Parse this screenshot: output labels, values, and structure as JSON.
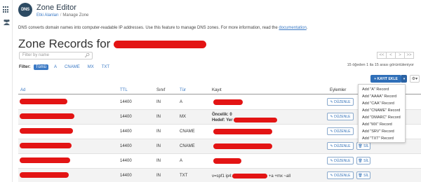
{
  "leftbar": {
    "icons": [
      "grid-icon",
      "users-icon"
    ]
  },
  "header": {
    "logo_text": "DNS",
    "title": "Zone Editor",
    "breadcrumb_home": "Etki Alanları",
    "breadcrumb_sep": "/",
    "breadcrumb_current": "Manage Zone"
  },
  "description": {
    "text": "DNS converts domain names into computer-readable IP addresses. Use this feature to manage DNS zones. For more information, read the",
    "link": "documentation",
    "suffix": "."
  },
  "page": {
    "title": "Zone Records for"
  },
  "search": {
    "placeholder": "Filter by name",
    "icon": "search-icon"
  },
  "filter": {
    "label": "Filter:",
    "chips": [
      "Tümü",
      "A",
      "CNAME",
      "MX",
      "TXT"
    ]
  },
  "pager": {
    "first": "<<",
    "prev": "<",
    "next": ">",
    "last": ">>"
  },
  "count_text": "15 öğeden 1 ila 15 arası görüntüleniyor",
  "add_record": {
    "label": "+ KAYIT EKLE",
    "caret": "▾",
    "settings": "⚙▾"
  },
  "dropdown": {
    "items": [
      "Add \"A\" Record",
      "Add \"AAAA\" Record",
      "Add \"CAA\" Record",
      "Add \"CNAME\" Record",
      "Add \"DMARC\" Record",
      "Add \"MX\" Record",
      "Add \"SRV\" Record",
      "Add \"TXT\" Record"
    ]
  },
  "table": {
    "columns": [
      "Ad",
      "TTL",
      "Sınıf",
      "Tür",
      "Kayıt",
      "Eylemler"
    ],
    "edit_label": "✎ DÜZENLE",
    "delete_label": "🗑 SİL",
    "rows": [
      {
        "ttl": "14400",
        "class": "IN",
        "type": "A",
        "record": ""
      },
      {
        "ttl": "14400",
        "class": "IN",
        "type": "MX",
        "priority": "Öncelik: 0",
        "target": "Hedef: Yer"
      },
      {
        "ttl": "14400",
        "class": "IN",
        "type": "CNAME",
        "record": ""
      },
      {
        "ttl": "14400",
        "class": "IN",
        "type": "CNAME",
        "record": ""
      },
      {
        "ttl": "14400",
        "class": "IN",
        "type": "A",
        "record": ""
      },
      {
        "ttl": "14400",
        "class": "IN",
        "type": "TXT",
        "record_prefix": "v=spf1 ip4:",
        "record_suffix": " +a +mx ~all"
      }
    ]
  },
  "colors": {
    "accent": "#3a79c5",
    "button": "#2f6fb8",
    "redaction": "#e31414"
  }
}
